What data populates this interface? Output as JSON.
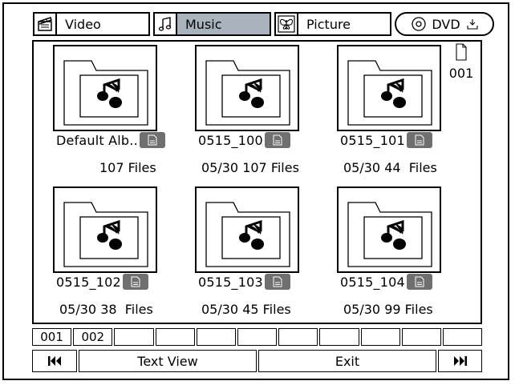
{
  "tabs": [
    {
      "label": "Video",
      "icon": "clapperboard-icon",
      "active": false
    },
    {
      "label": "Music",
      "icon": "music-note-icon",
      "active": true
    },
    {
      "label": "Picture",
      "icon": "butterfly-icon",
      "active": false
    },
    {
      "label": "DVD",
      "icon": "disc-icon",
      "active": false
    }
  ],
  "page_indicator": "001",
  "albums": [
    {
      "name": "Default Alb..",
      "info": "107 Files"
    },
    {
      "name": "0515_100",
      "info": "05/30 107 Files"
    },
    {
      "name": "0515_101",
      "info": "05/30 44  Files"
    },
    {
      "name": "0515_102",
      "info": "05/30 38  Files"
    },
    {
      "name": "0515_103",
      "info": "05/30 45 Files"
    },
    {
      "name": "0515_104",
      "info": "05/30 99 Files"
    }
  ],
  "pages": [
    "001",
    "002",
    "",
    "",
    "",
    "",
    "",
    "",
    "",
    "",
    ""
  ],
  "buttons": {
    "prev": "⏮",
    "text_view": "Text View",
    "exit": "Exit",
    "next": "⏭"
  },
  "colors": {
    "active_tab": "#a9b3bd",
    "badge": "#6f6f6f"
  }
}
